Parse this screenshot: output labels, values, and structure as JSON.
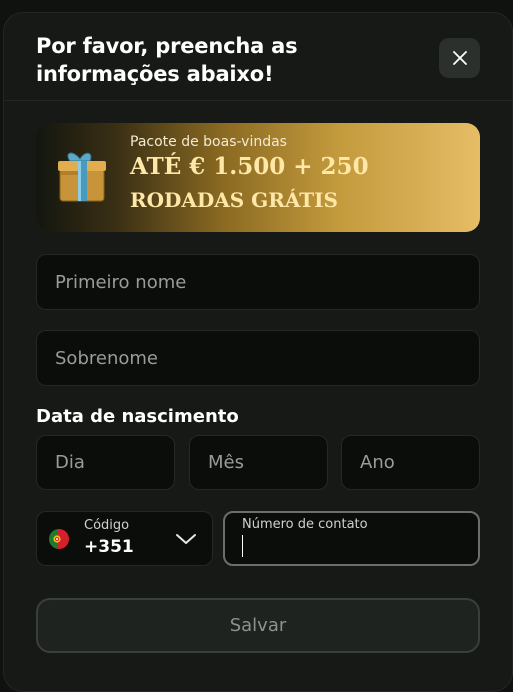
{
  "dialog": {
    "title": "Por favor, preencha as informações abaixo!",
    "close_icon": "close-icon"
  },
  "banner": {
    "icon": "gift-icon",
    "subtitle": "Pacote de boas-vindas",
    "amount": "ATÉ € 1.500 + 250",
    "spins": "RODADAS GRÁTIS",
    "colors": {
      "gradient_start": "#13160f",
      "gradient_end": "#e6bc66",
      "text": "#ffe7a8"
    }
  },
  "form": {
    "first_name_placeholder": "Primeiro nome",
    "last_name_placeholder": "Sobrenome",
    "birth_date_label": "Data de nascimento",
    "day_placeholder": "Dia",
    "month_placeholder": "Mês",
    "year_placeholder": "Ano",
    "country_code": {
      "label": "Código",
      "value": "+351",
      "flag_icon": "portugal-flag-icon",
      "dropdown_icon": "chevron-down-icon"
    },
    "phone_label": "Número de contato",
    "phone_value": "",
    "save_label": "Salvar"
  },
  "colors": {
    "background": "#161915",
    "field_background": "#0b0d0a",
    "field_border": "#252923",
    "focused_border": "#6a6f6a",
    "button_background": "#1f231f"
  }
}
